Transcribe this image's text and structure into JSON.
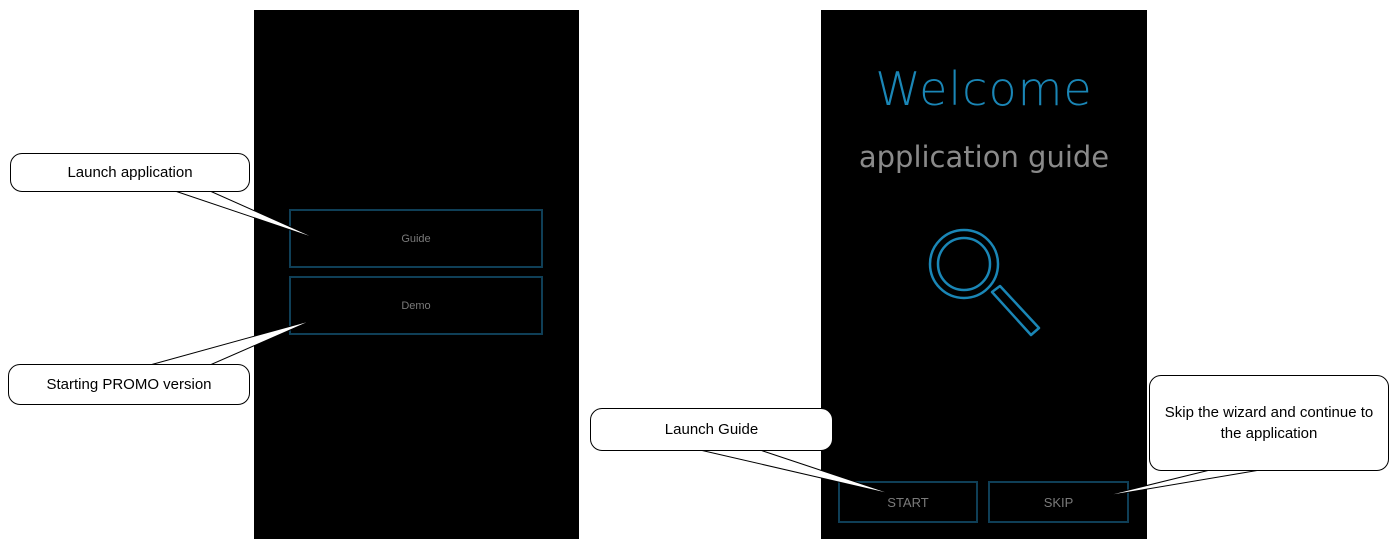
{
  "left_screen": {
    "guide_label": "Guide",
    "demo_label": "Demo"
  },
  "right_screen": {
    "title": "Welcome",
    "subtitle": "application guide",
    "icon": "search-icon",
    "start_label": "START",
    "skip_label": "SKIP"
  },
  "callouts": {
    "launch_application": "Launch application",
    "starting_promo": "Starting PROMO version",
    "launch_guide": "Launch Guide",
    "skip_wizard": "Skip the wizard and continue to the application"
  },
  "colors": {
    "screen_background": "#000000",
    "accent_blue": "#1a86b6",
    "button_border": "#0f3f57",
    "muted_text": "#7a7a7a"
  }
}
